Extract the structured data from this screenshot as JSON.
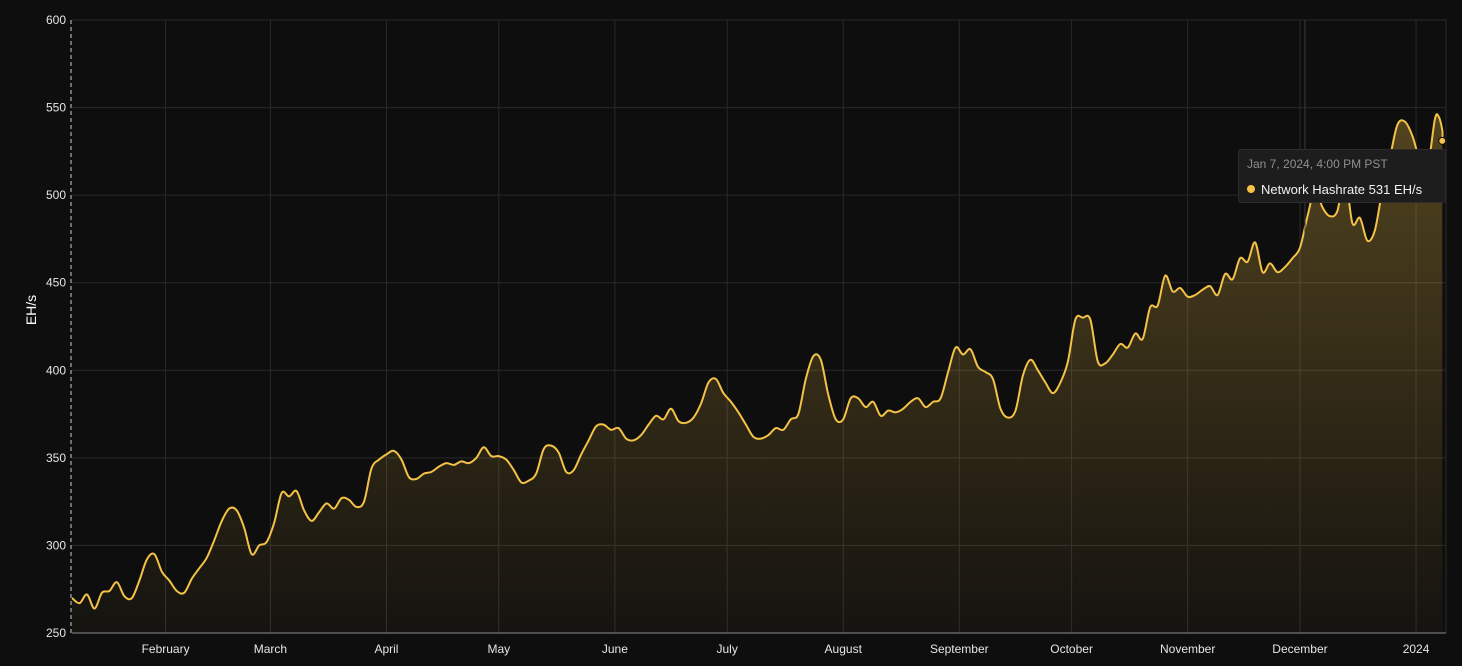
{
  "colors": {
    "background": "#0e0e0e",
    "grid": "#2a2a2a",
    "line": "#f4c246",
    "text": "#e6e6e6"
  },
  "chart_data": {
    "type": "area",
    "ylabel": "EH/s",
    "ylim": [
      250,
      600
    ],
    "yticks": [
      250,
      300,
      350,
      400,
      450,
      500,
      550,
      600
    ],
    "xlim": [
      "2023-01-07",
      "2024-01-09"
    ],
    "xticks": [
      {
        "label": "February",
        "date": "2023-02-01"
      },
      {
        "label": "March",
        "date": "2023-03-01"
      },
      {
        "label": "April",
        "date": "2023-04-01"
      },
      {
        "label": "May",
        "date": "2023-05-01"
      },
      {
        "label": "June",
        "date": "2023-06-01"
      },
      {
        "label": "July",
        "date": "2023-07-01"
      },
      {
        "label": "August",
        "date": "2023-08-01"
      },
      {
        "label": "September",
        "date": "2023-09-01"
      },
      {
        "label": "October",
        "date": "2023-10-01"
      },
      {
        "label": "November",
        "date": "2023-11-01"
      },
      {
        "label": "December",
        "date": "2023-12-01"
      },
      {
        "label": "2024",
        "date": "2024-01-01"
      }
    ],
    "grid": true,
    "series": [
      {
        "name": "Network Hashrate",
        "points": [
          [
            "2023-01-07",
            270
          ],
          [
            "2023-01-09",
            267
          ],
          [
            "2023-01-11",
            272
          ],
          [
            "2023-01-13",
            264
          ],
          [
            "2023-01-15",
            273
          ],
          [
            "2023-01-17",
            274
          ],
          [
            "2023-01-19",
            279
          ],
          [
            "2023-01-21",
            271
          ],
          [
            "2023-01-23",
            270
          ],
          [
            "2023-01-25",
            280
          ],
          [
            "2023-01-27",
            292
          ],
          [
            "2023-01-29",
            295
          ],
          [
            "2023-01-31",
            285
          ],
          [
            "2023-02-02",
            280
          ],
          [
            "2023-02-04",
            274
          ],
          [
            "2023-02-06",
            273
          ],
          [
            "2023-02-08",
            281
          ],
          [
            "2023-02-10",
            287
          ],
          [
            "2023-02-12",
            293
          ],
          [
            "2023-02-14",
            303
          ],
          [
            "2023-02-16",
            314
          ],
          [
            "2023-02-18",
            321
          ],
          [
            "2023-02-20",
            320
          ],
          [
            "2023-02-22",
            310
          ],
          [
            "2023-02-24",
            295
          ],
          [
            "2023-02-26",
            300
          ],
          [
            "2023-02-28",
            302
          ],
          [
            "2023-03-02",
            313
          ],
          [
            "2023-03-04",
            330
          ],
          [
            "2023-03-06",
            328
          ],
          [
            "2023-03-08",
            331
          ],
          [
            "2023-03-10",
            320
          ],
          [
            "2023-03-12",
            314
          ],
          [
            "2023-03-14",
            319
          ],
          [
            "2023-03-16",
            324
          ],
          [
            "2023-03-18",
            321
          ],
          [
            "2023-03-20",
            327
          ],
          [
            "2023-03-22",
            326
          ],
          [
            "2023-03-24",
            322
          ],
          [
            "2023-03-26",
            325
          ],
          [
            "2023-03-28",
            344
          ],
          [
            "2023-03-30",
            349
          ],
          [
            "2023-04-01",
            352
          ],
          [
            "2023-04-03",
            354
          ],
          [
            "2023-04-05",
            349
          ],
          [
            "2023-04-07",
            339
          ],
          [
            "2023-04-09",
            338
          ],
          [
            "2023-04-11",
            341
          ],
          [
            "2023-04-13",
            342
          ],
          [
            "2023-04-15",
            345
          ],
          [
            "2023-04-17",
            347
          ],
          [
            "2023-04-19",
            346
          ],
          [
            "2023-04-21",
            348
          ],
          [
            "2023-04-23",
            347
          ],
          [
            "2023-04-25",
            350
          ],
          [
            "2023-04-27",
            356
          ],
          [
            "2023-04-29",
            351
          ],
          [
            "2023-05-01",
            351
          ],
          [
            "2023-05-03",
            349
          ],
          [
            "2023-05-05",
            343
          ],
          [
            "2023-05-07",
            336
          ],
          [
            "2023-05-09",
            337
          ],
          [
            "2023-05-11",
            341
          ],
          [
            "2023-05-13",
            355
          ],
          [
            "2023-05-15",
            357
          ],
          [
            "2023-05-17",
            353
          ],
          [
            "2023-05-19",
            342
          ],
          [
            "2023-05-21",
            343
          ],
          [
            "2023-05-23",
            352
          ],
          [
            "2023-05-25",
            360
          ],
          [
            "2023-05-27",
            368
          ],
          [
            "2023-05-29",
            369
          ],
          [
            "2023-05-31",
            366
          ],
          [
            "2023-06-02",
            367
          ],
          [
            "2023-06-04",
            361
          ],
          [
            "2023-06-06",
            360
          ],
          [
            "2023-06-08",
            363
          ],
          [
            "2023-06-10",
            369
          ],
          [
            "2023-06-12",
            374
          ],
          [
            "2023-06-14",
            372
          ],
          [
            "2023-06-16",
            378
          ],
          [
            "2023-06-18",
            371
          ],
          [
            "2023-06-20",
            370
          ],
          [
            "2023-06-22",
            373
          ],
          [
            "2023-06-24",
            381
          ],
          [
            "2023-06-26",
            393
          ],
          [
            "2023-06-28",
            395
          ],
          [
            "2023-06-30",
            387
          ],
          [
            "2023-07-02",
            382
          ],
          [
            "2023-07-04",
            376
          ],
          [
            "2023-07-06",
            369
          ],
          [
            "2023-07-08",
            362
          ],
          [
            "2023-07-10",
            361
          ],
          [
            "2023-07-12",
            363
          ],
          [
            "2023-07-14",
            367
          ],
          [
            "2023-07-16",
            366
          ],
          [
            "2023-07-18",
            372
          ],
          [
            "2023-07-20",
            375
          ],
          [
            "2023-07-22",
            395
          ],
          [
            "2023-07-24",
            408
          ],
          [
            "2023-07-26",
            406
          ],
          [
            "2023-07-28",
            386
          ],
          [
            "2023-07-30",
            372
          ],
          [
            "2023-08-01",
            372
          ],
          [
            "2023-08-03",
            384
          ],
          [
            "2023-08-05",
            384
          ],
          [
            "2023-08-07",
            379
          ],
          [
            "2023-08-09",
            382
          ],
          [
            "2023-08-11",
            374
          ],
          [
            "2023-08-13",
            377
          ],
          [
            "2023-08-15",
            376
          ],
          [
            "2023-08-17",
            378
          ],
          [
            "2023-08-19",
            382
          ],
          [
            "2023-08-21",
            384
          ],
          [
            "2023-08-23",
            379
          ],
          [
            "2023-08-25",
            382
          ],
          [
            "2023-08-27",
            384
          ],
          [
            "2023-08-29",
            399
          ],
          [
            "2023-08-31",
            413
          ],
          [
            "2023-09-02",
            409
          ],
          [
            "2023-09-04",
            412
          ],
          [
            "2023-09-06",
            402
          ],
          [
            "2023-09-08",
            399
          ],
          [
            "2023-09-10",
            395
          ],
          [
            "2023-09-12",
            378
          ],
          [
            "2023-09-14",
            373
          ],
          [
            "2023-09-16",
            377
          ],
          [
            "2023-09-18",
            397
          ],
          [
            "2023-09-20",
            406
          ],
          [
            "2023-09-22",
            400
          ],
          [
            "2023-09-24",
            393
          ],
          [
            "2023-09-26",
            387
          ],
          [
            "2023-09-28",
            393
          ],
          [
            "2023-09-30",
            405
          ],
          [
            "2023-10-02",
            429
          ],
          [
            "2023-10-04",
            430
          ],
          [
            "2023-10-06",
            429
          ],
          [
            "2023-10-08",
            405
          ],
          [
            "2023-10-10",
            404
          ],
          [
            "2023-10-12",
            409
          ],
          [
            "2023-10-14",
            415
          ],
          [
            "2023-10-16",
            413
          ],
          [
            "2023-10-18",
            421
          ],
          [
            "2023-10-20",
            418
          ],
          [
            "2023-10-22",
            436
          ],
          [
            "2023-10-24",
            437
          ],
          [
            "2023-10-26",
            454
          ],
          [
            "2023-10-28",
            445
          ],
          [
            "2023-10-30",
            447
          ],
          [
            "2023-11-01",
            442
          ],
          [
            "2023-11-03",
            443
          ],
          [
            "2023-11-05",
            446
          ],
          [
            "2023-11-07",
            448
          ],
          [
            "2023-11-09",
            443
          ],
          [
            "2023-11-11",
            455
          ],
          [
            "2023-11-13",
            452
          ],
          [
            "2023-11-15",
            464
          ],
          [
            "2023-11-17",
            462
          ],
          [
            "2023-11-19",
            473
          ],
          [
            "2023-11-21",
            456
          ],
          [
            "2023-11-23",
            461
          ],
          [
            "2023-11-25",
            456
          ],
          [
            "2023-11-27",
            459
          ],
          [
            "2023-11-29",
            464
          ],
          [
            "2023-12-01",
            470
          ],
          [
            "2023-12-03",
            488
          ],
          [
            "2023-12-05",
            503
          ],
          [
            "2023-12-07",
            493
          ],
          [
            "2023-12-09",
            488
          ],
          [
            "2023-12-11",
            491
          ],
          [
            "2023-12-13",
            511
          ],
          [
            "2023-12-15",
            484
          ],
          [
            "2023-12-17",
            487
          ],
          [
            "2023-12-19",
            474
          ],
          [
            "2023-12-21",
            480
          ],
          [
            "2023-12-23",
            503
          ],
          [
            "2023-12-25",
            521
          ],
          [
            "2023-12-27",
            540
          ],
          [
            "2023-12-29",
            542
          ],
          [
            "2023-12-31",
            534
          ],
          [
            "2024-01-02",
            520
          ],
          [
            "2024-01-04",
            515
          ],
          [
            "2024-01-06",
            543
          ],
          [
            "2024-01-07",
            545
          ],
          [
            "2024-01-08",
            537
          ],
          [
            "2024-01-08",
            531
          ]
        ]
      }
    ],
    "tooltip": {
      "date_label": "Jan 7, 2024, 4:00 PM PST",
      "series_label": "Network Hashrate",
      "value_label": "531 EH/s"
    }
  }
}
